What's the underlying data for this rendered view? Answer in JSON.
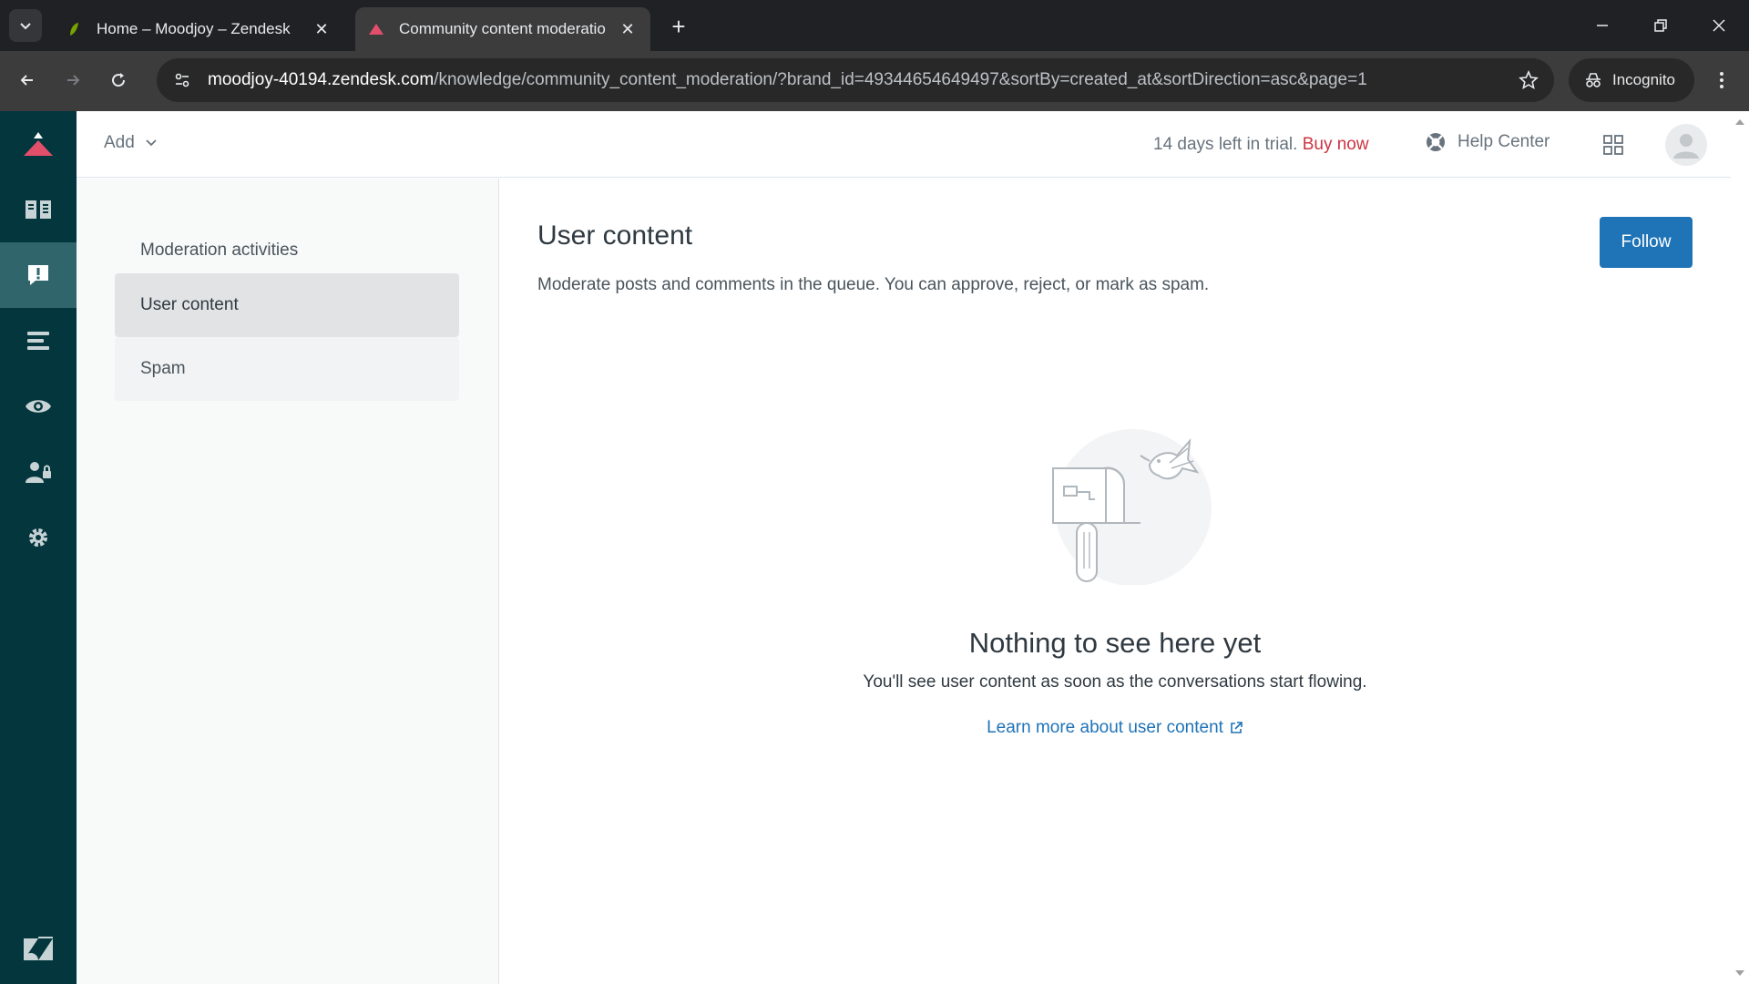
{
  "browser": {
    "tabs": [
      {
        "title": "Home – Moodjoy – Zendesk",
        "active": false
      },
      {
        "title": "Community content moderatio",
        "active": true
      }
    ],
    "url_host": "moodjoy-40194.zendesk.com",
    "url_path": "/knowledge/community_content_moderation/?brand_id=49344654649497&sortBy=created_at&sortDirection=asc&page=1",
    "incognito_label": "Incognito"
  },
  "topbar": {
    "add_label": "Add",
    "trial_text": "14 days left in trial.",
    "buy_now": "Buy now",
    "help_center": "Help Center"
  },
  "rail": {
    "items": [
      "zendesk-guide-logo",
      "knowledge-icon",
      "moderation-icon",
      "arrange-icon",
      "view-icon",
      "user-permissions-icon",
      "settings-icon"
    ]
  },
  "sidenav": {
    "heading": "Moderation activities",
    "items": [
      {
        "label": "User content",
        "selected": true
      },
      {
        "label": "Spam",
        "selected": false
      }
    ]
  },
  "main": {
    "title": "User content",
    "description": "Moderate posts and comments in the queue. You can approve, reject, or mark as spam.",
    "follow_label": "Follow",
    "empty_title": "Nothing to see here yet",
    "empty_subtitle": "You'll see user content as soon as the conversations start flowing.",
    "learn_more": "Learn more about user content"
  },
  "colors": {
    "rail_bg": "#03363d",
    "rail_active": "#30656c",
    "accent_blue": "#1f73b7",
    "buy_red": "#cc3340"
  }
}
